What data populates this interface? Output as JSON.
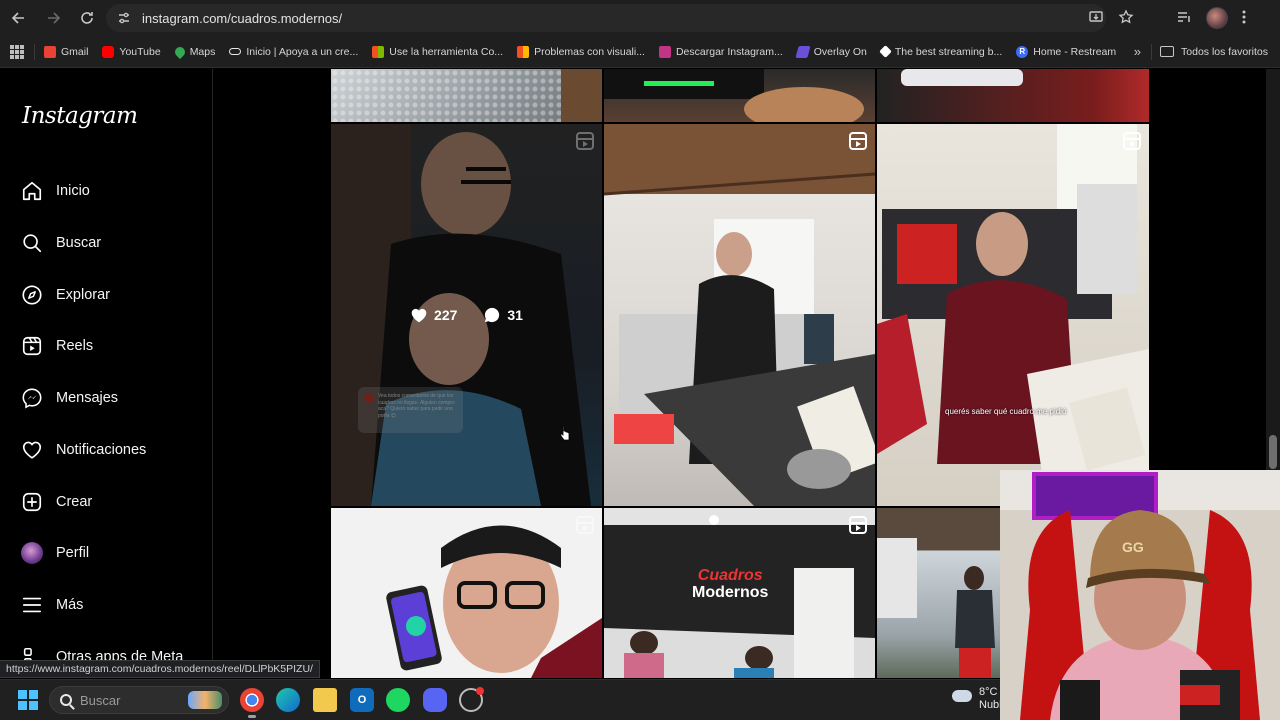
{
  "browser": {
    "url": "instagram.com/cuadros.modernos/",
    "bookmarks": [
      {
        "label": "Gmail",
        "color": "#ea4335"
      },
      {
        "label": "YouTube",
        "color": "#ff0000"
      },
      {
        "label": "Maps",
        "color": "#34a853"
      },
      {
        "label": "Inicio | Apoya a un cre...",
        "color": "#e6e6e6"
      },
      {
        "label": "Use la herramienta Co...",
        "color": "#f25022"
      },
      {
        "label": "Problemas con visuali...",
        "color": "#f25022"
      },
      {
        "label": "Descargar Instagram...",
        "color": "#c13584"
      },
      {
        "label": "Overlay On",
        "color": "#6b4fd8"
      },
      {
        "label": "The best streaming b...",
        "color": "#ffffff"
      },
      {
        "label": "Home - Restream",
        "color": "#3b6cf5"
      }
    ],
    "all_bookmarks_label": "Todos los favoritos",
    "status_url": "https://www.instagram.com/cuadros.modernos/reel/DLlPbK5PIZU/"
  },
  "sidebar": {
    "logo": "Instagram",
    "items": [
      {
        "label": "Inicio",
        "icon": "home-icon"
      },
      {
        "label": "Buscar",
        "icon": "search-icon"
      },
      {
        "label": "Explorar",
        "icon": "compass-icon"
      },
      {
        "label": "Reels",
        "icon": "reels-icon"
      },
      {
        "label": "Mensajes",
        "icon": "messenger-icon"
      },
      {
        "label": "Notificaciones",
        "icon": "heart-icon"
      },
      {
        "label": "Crear",
        "icon": "plus-square-icon"
      },
      {
        "label": "Perfil",
        "icon": "avatar"
      },
      {
        "label": "Más",
        "icon": "menu-icon"
      },
      {
        "label": "Otras apps de Meta",
        "icon": "meta-apps-icon"
      }
    ]
  },
  "grid": {
    "hovered_post": {
      "likes": "227",
      "comments": "31"
    },
    "captions": {
      "post_tile_3": "querés saber qué cuadro me pidió",
      "post_tile_1_comment": "Vea todos comentarios de que los cuadros no llegan. Alguien compro aca? Quiero saber para pedir uno porfa 😊"
    },
    "sign_brand_1": "Cuadros",
    "sign_brand_2": "Modernos"
  },
  "taskbar": {
    "search_placeholder": "Buscar",
    "temperature": "8°C",
    "weather_text": "Nubl"
  }
}
